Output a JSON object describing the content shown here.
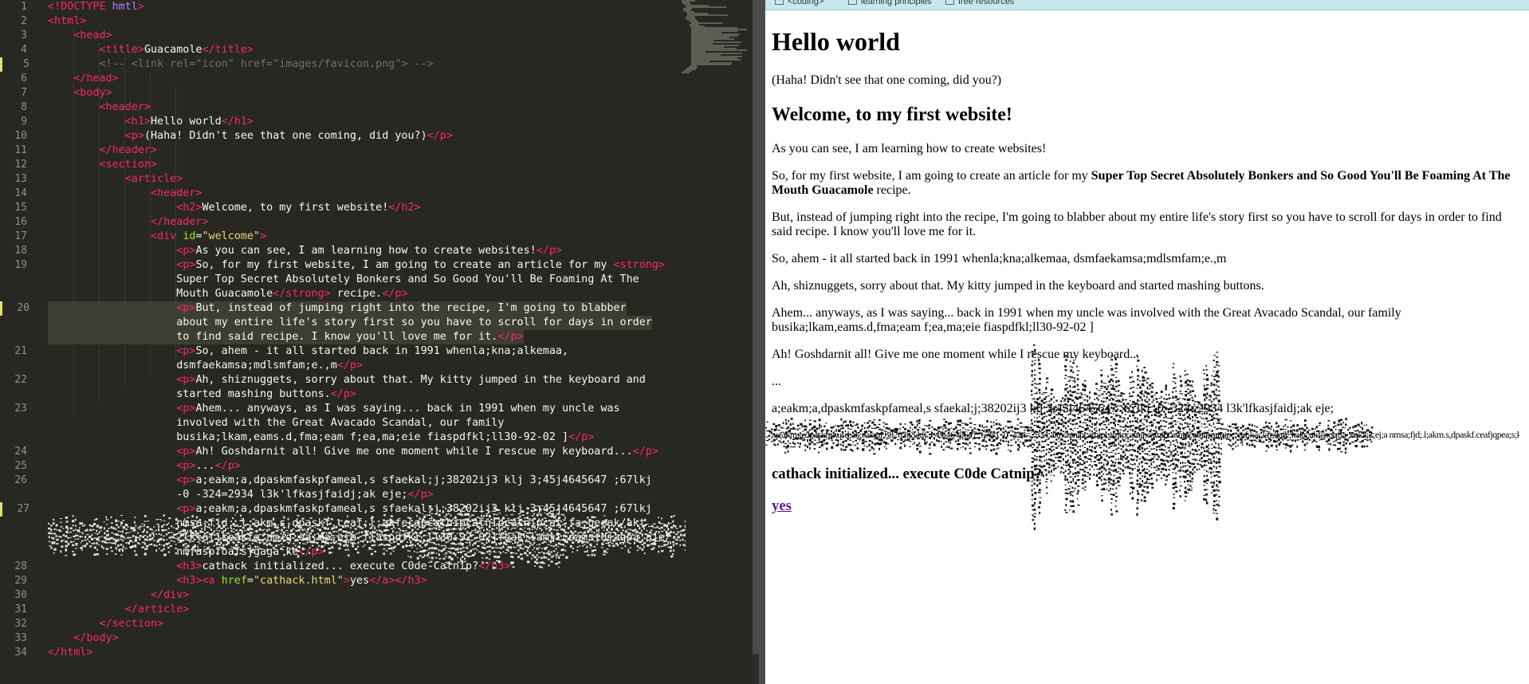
{
  "editor": {
    "lines": [
      {
        "num": "1",
        "html": "<span class=\"tag\">&lt;!</span><span class=\"doctype\">DOCTYPE</span> <span class=\"kw\">hmtl</span><span class=\"tag\">&gt;</span>"
      },
      {
        "num": "2",
        "html": "<span class=\"tag\">&lt;html&gt;</span>"
      },
      {
        "num": "3",
        "html": "    <span class=\"tag\">&lt;head&gt;</span>"
      },
      {
        "num": "4",
        "html": "        <span class=\"tag\">&lt;title&gt;</span>Guacamole<span class=\"tag\">&lt;/title&gt;</span>"
      },
      {
        "num": "5",
        "html": "        <span class=\"com\">&lt;!-- &lt;link rel=\"icon\" href=\"images/favicon.png\"&gt; --&gt;</span>"
      },
      {
        "num": "6",
        "html": "    <span class=\"tag\">&lt;/head&gt;</span>"
      },
      {
        "num": "7",
        "html": "    <span class=\"tag\">&lt;body&gt;</span>"
      },
      {
        "num": "8",
        "html": "        <span class=\"tag\">&lt;header&gt;</span>"
      },
      {
        "num": "9",
        "html": "            <span class=\"tag\">&lt;h1&gt;</span>Hello world<span class=\"tag\">&lt;/h1&gt;</span>"
      },
      {
        "num": "10",
        "html": "            <span class=\"tag\">&lt;p&gt;</span>(Haha! Didn't see that one coming, did you?)<span class=\"tag\">&lt;/p&gt;</span>"
      },
      {
        "num": "11",
        "html": "        <span class=\"tag\">&lt;/header&gt;</span>"
      },
      {
        "num": "12",
        "html": "        <span class=\"tag\">&lt;section&gt;</span>"
      },
      {
        "num": "13",
        "html": "            <span class=\"tag\">&lt;article&gt;</span>"
      },
      {
        "num": "14",
        "html": "                <span class=\"tag\">&lt;header&gt;</span>"
      },
      {
        "num": "15",
        "html": "                    <span class=\"tag\">&lt;h2&gt;</span>Welcome, to my first website!<span class=\"tag\">&lt;/h2&gt;</span>"
      },
      {
        "num": "16",
        "html": "                <span class=\"tag\">&lt;/header&gt;</span>"
      },
      {
        "num": "17",
        "html": "                <span class=\"tag\">&lt;div</span> <span class=\"attr\">id</span>=<span class=\"str\">\"welcome\"</span><span class=\"tag\">&gt;</span>"
      },
      {
        "num": "18",
        "html": "                    <span class=\"tag\">&lt;p&gt;</span>As you can see, I am learning how to create websites!<span class=\"tag\">&lt;/p&gt;</span>"
      },
      {
        "num": "19",
        "html": "                    <span class=\"tag\">&lt;p&gt;</span>So, for my first website, I am going to create an article for my <span class=\"tag\">&lt;strong&gt;</span>"
      },
      {
        "num": "",
        "html": "                    Super Top Secret Absolutely Bonkers and So Good You'll Be Foaming At The"
      },
      {
        "num": "",
        "html": "                    Mouth Guacamole<span class=\"tag\">&lt;/strong&gt;</span> recipe.<span class=\"tag\">&lt;/p&gt;</span>"
      },
      {
        "num": "20",
        "html": "                    <span class=\"tag\">&lt;p&gt;</span>But, instead of jumping right into the recipe, I'm going to blabber"
      },
      {
        "num": "",
        "html": "                    about my entire life's story first so you have to scroll for days in order"
      },
      {
        "num": "",
        "html": "                    to find said recipe. I know you'll love me for it.<span class=\"tag\">&lt;/p&gt;</span>"
      },
      {
        "num": "21",
        "html": "                    <span class=\"tag\">&lt;p&gt;</span>So, ahem - it all started back in 1991 whenla;kna;alkemaa,"
      },
      {
        "num": "",
        "html": "                    dsmfaekamsa;mdlsmfam;e.,m<span class=\"tag\">&lt;/p&gt;</span>"
      },
      {
        "num": "22",
        "html": "                    <span class=\"tag\">&lt;p&gt;</span>Ah, shiznuggets, sorry about that. My kitty jumped in the keyboard and"
      },
      {
        "num": "",
        "html": "                    started mashing buttons.<span class=\"tag\">&lt;/p&gt;</span>"
      },
      {
        "num": "23",
        "html": "                    <span class=\"tag\">&lt;p&gt;</span>Ahem... anyways, as I was saying... back in 1991 when my uncle was"
      },
      {
        "num": "",
        "html": "                    involved with the Great Avacado Scandal, our family"
      },
      {
        "num": "",
        "html": "                    busika;lkam,eams.d,fma;eam f;ea,ma;eie fiaspdfkl;ll30-92-02 ]<span class=\"tag\">&lt;/p&gt;</span>"
      },
      {
        "num": "24",
        "html": "                    <span class=\"tag\">&lt;p&gt;</span>Ah! Goshdarnit all! Give me one moment while I rescue my keyboard...<span class=\"tag\">&lt;/p&gt;</span>"
      },
      {
        "num": "25",
        "html": "                    <span class=\"tag\">&lt;p&gt;</span>...<span class=\"tag\">&lt;/p&gt;</span>"
      },
      {
        "num": "26",
        "html": "                    <span class=\"tag\">&lt;p&gt;</span>a;eakm;a,dpaskmfaskpfameal,s sfaekal;j;38202ij3 klj 3;45j4645647 ;67lkj"
      },
      {
        "num": "",
        "html": "                    -0 -324=2934 l3k'lfkasjfaidj;ak eje;<span class=\"tag\">&lt;/p&gt;</span>"
      },
      {
        "num": "27",
        "html": "                    <span class=\"tag\">&lt;p&gt;</span>a;eakm;a,dpaskmfaskpfameal,s sfaekal;j;38202ij3 klj 3;45j4645647 ;67lkj"
      },
      {
        "num": "",
        "html": "                    nmsa;fjd;.l;akm.s,dpaskf.ceaf;l;akfecapcatnipcatnipcatnipcat-fa;ueeak/akt"
      },
      {
        "num": "",
        "html": "                    2lklafjkeakfa;nm/g;ea,ma;eie fiaspdfkl;ll30-92-02]feak;lamsl;oamsfdjagpa;aje/"
      },
      {
        "num": "",
        "html": "                    nmfaspfoafsjgaga ke<span class=\"tag\">&lt;/p&gt;</span>"
      },
      {
        "num": "28",
        "html": "                    <span class=\"tag\">&lt;h3&gt;</span>cathack initialized... execute C0de Catnip?<span class=\"tag\">&lt;/h3&gt;</span>"
      },
      {
        "num": "29",
        "html": "                    <span class=\"tag\">&lt;h3&gt;&lt;a</span> <span class=\"attr\">href</span>=<span class=\"str\">\"cathack.html\"</span><span class=\"tag\">&gt;</span>yes<span class=\"tag\">&lt;/a&gt;&lt;/h3&gt;</span>"
      },
      {
        "num": "30",
        "html": "                <span class=\"tag\">&lt;/div&gt;</span>"
      },
      {
        "num": "31",
        "html": "            <span class=\"tag\">&lt;/article&gt;</span>"
      },
      {
        "num": "32",
        "html": "        <span class=\"tag\">&lt;/section&gt;</span>"
      },
      {
        "num": "33",
        "html": "    <span class=\"tag\">&lt;/body&gt;</span>"
      },
      {
        "num": "34",
        "html": "<span class=\"tag\">&lt;/html&gt;</span>"
      }
    ]
  },
  "browser": {
    "bookmarks": [
      "<coding>",
      "learning principles",
      "free resources"
    ],
    "h1": "Hello world",
    "tagline": "(Haha! Didn't see that one coming, did you?)",
    "h2": "Welcome, to my first website!",
    "p1": "As you can see, I am learning how to create websites!",
    "p2_before": "So, for my first website, I am going to create an article for my ",
    "p2_strong": "Super Top Secret Absolutely Bonkers and So Good You'll Be Foaming At The Mouth Guacamole",
    "p2_after": " recipe.",
    "p3": "But, instead of jumping right into the recipe, I'm going to blabber about my entire life's story first so you have to scroll for days in order to find said recipe. I know you'll love me for it.",
    "p4": "So, ahem - it all started back in 1991 whenla;kna;alkemaa, dsmfaekamsa;mdlsmfam;e.,m",
    "p5": "Ah, shiznuggets, sorry about that. My kitty jumped in the keyboard and started mashing buttons.",
    "p6": "Ahem... anyways, as I was saying... back in 1991 when my uncle was involved with the Great Avacado Scandal, our family busika;lkam,eams.d,fma;eam f;ea,ma;eie fiaspdfkl;ll30-92-02 ]",
    "p7": "Ah! Goshdarnit all! Give me one moment while I rescue my keyboard...",
    "p8": "...",
    "p9": "a;eakm;a,dpaskmfaskpfameal,s sfaekal;j;38202ij3 klj 3;45j4645647 ;67lkj -0 -324=2934 l3k'lfkasjfaidj;ak eje;",
    "p10": "a;eakm;a,dpaskmfa;sd;ak;eak;aj;38202ij3 klj 3;45j4645647 ;67lkj -0 -324=2934;akncatnipcatnipcatnipcatnipcatnipcatnipcatnipcatnipc;eaf;ka;2;ft;kafe;kaks;akfjisoqfla ;eaka;2;ej;a nmsa;fjd;.l;akm.s,dpaskf.ceafjqpea;s;kakfc;jkaf;;lcmfaspfoafsjgaga ke",
    "h3a": "cathack initialized... execute C0de Catnip?",
    "link": "yes"
  }
}
